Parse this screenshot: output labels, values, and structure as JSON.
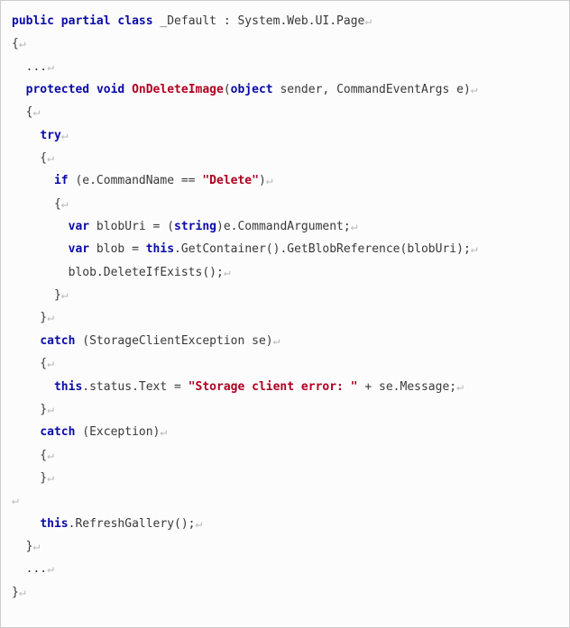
{
  "code": {
    "crlf": "↵",
    "lines": [
      [
        {
          "cls": "kw",
          "t": "public"
        },
        {
          "cls": "pln",
          "t": " "
        },
        {
          "cls": "kw",
          "t": "partial"
        },
        {
          "cls": "pln",
          "t": " "
        },
        {
          "cls": "kw",
          "t": "class"
        },
        {
          "cls": "pln",
          "t": " _Default : System.Web.UI.Page"
        }
      ],
      [
        {
          "cls": "pln",
          "t": "{"
        }
      ],
      [
        {
          "cls": "pln",
          "t": "  ..."
        }
      ],
      [
        {
          "cls": "pln",
          "t": "  "
        },
        {
          "cls": "kw",
          "t": "protected"
        },
        {
          "cls": "pln",
          "t": " "
        },
        {
          "cls": "kw",
          "t": "void"
        },
        {
          "cls": "pln",
          "t": " "
        },
        {
          "cls": "fn",
          "t": "OnDeleteImage"
        },
        {
          "cls": "pln",
          "t": "("
        },
        {
          "cls": "typ",
          "t": "object"
        },
        {
          "cls": "pln",
          "t": " sender, CommandEventArgs e)"
        }
      ],
      [
        {
          "cls": "pln",
          "t": "  {"
        }
      ],
      [
        {
          "cls": "pln",
          "t": "    "
        },
        {
          "cls": "kw",
          "t": "try"
        }
      ],
      [
        {
          "cls": "pln",
          "t": "    {"
        }
      ],
      [
        {
          "cls": "pln",
          "t": "      "
        },
        {
          "cls": "kw",
          "t": "if"
        },
        {
          "cls": "pln",
          "t": " (e.CommandName == "
        },
        {
          "cls": "str",
          "t": "\"Delete\""
        },
        {
          "cls": "pln",
          "t": ")"
        }
      ],
      [
        {
          "cls": "pln",
          "t": "      {"
        }
      ],
      [
        {
          "cls": "pln",
          "t": "        "
        },
        {
          "cls": "kw",
          "t": "var"
        },
        {
          "cls": "pln",
          "t": " blobUri = ("
        },
        {
          "cls": "typ",
          "t": "string"
        },
        {
          "cls": "pln",
          "t": ")e.CommandArgument;"
        }
      ],
      [
        {
          "cls": "pln",
          "t": "        "
        },
        {
          "cls": "kw",
          "t": "var"
        },
        {
          "cls": "pln",
          "t": " blob = "
        },
        {
          "cls": "kw",
          "t": "this"
        },
        {
          "cls": "pln",
          "t": ".GetContainer().GetBlobReference(blobUri);"
        }
      ],
      [
        {
          "cls": "pln",
          "t": "        blob.DeleteIfExists();"
        }
      ],
      [
        {
          "cls": "pln",
          "t": "      }"
        }
      ],
      [
        {
          "cls": "pln",
          "t": "    }"
        }
      ],
      [
        {
          "cls": "pln",
          "t": "    "
        },
        {
          "cls": "kw",
          "t": "catch"
        },
        {
          "cls": "pln",
          "t": " (StorageClientException se)"
        }
      ],
      [
        {
          "cls": "pln",
          "t": "    {"
        }
      ],
      [
        {
          "cls": "pln",
          "t": "      "
        },
        {
          "cls": "kw",
          "t": "this"
        },
        {
          "cls": "pln",
          "t": ".status.Text = "
        },
        {
          "cls": "str",
          "t": "\"Storage client error: \""
        },
        {
          "cls": "pln",
          "t": " + se.Message;"
        }
      ],
      [
        {
          "cls": "pln",
          "t": "    }"
        }
      ],
      [
        {
          "cls": "pln",
          "t": "    "
        },
        {
          "cls": "kw",
          "t": "catch"
        },
        {
          "cls": "pln",
          "t": " (Exception)"
        }
      ],
      [
        {
          "cls": "pln",
          "t": "    {"
        }
      ],
      [
        {
          "cls": "pln",
          "t": "    }"
        }
      ],
      [
        {
          "cls": "pln",
          "t": ""
        }
      ],
      [
        {
          "cls": "pln",
          "t": "    "
        },
        {
          "cls": "kw",
          "t": "this"
        },
        {
          "cls": "pln",
          "t": ".RefreshGallery();"
        }
      ],
      [
        {
          "cls": "pln",
          "t": "  }"
        }
      ],
      [
        {
          "cls": "pln",
          "t": "  ..."
        }
      ],
      [
        {
          "cls": "pln",
          "t": "}"
        }
      ]
    ]
  }
}
